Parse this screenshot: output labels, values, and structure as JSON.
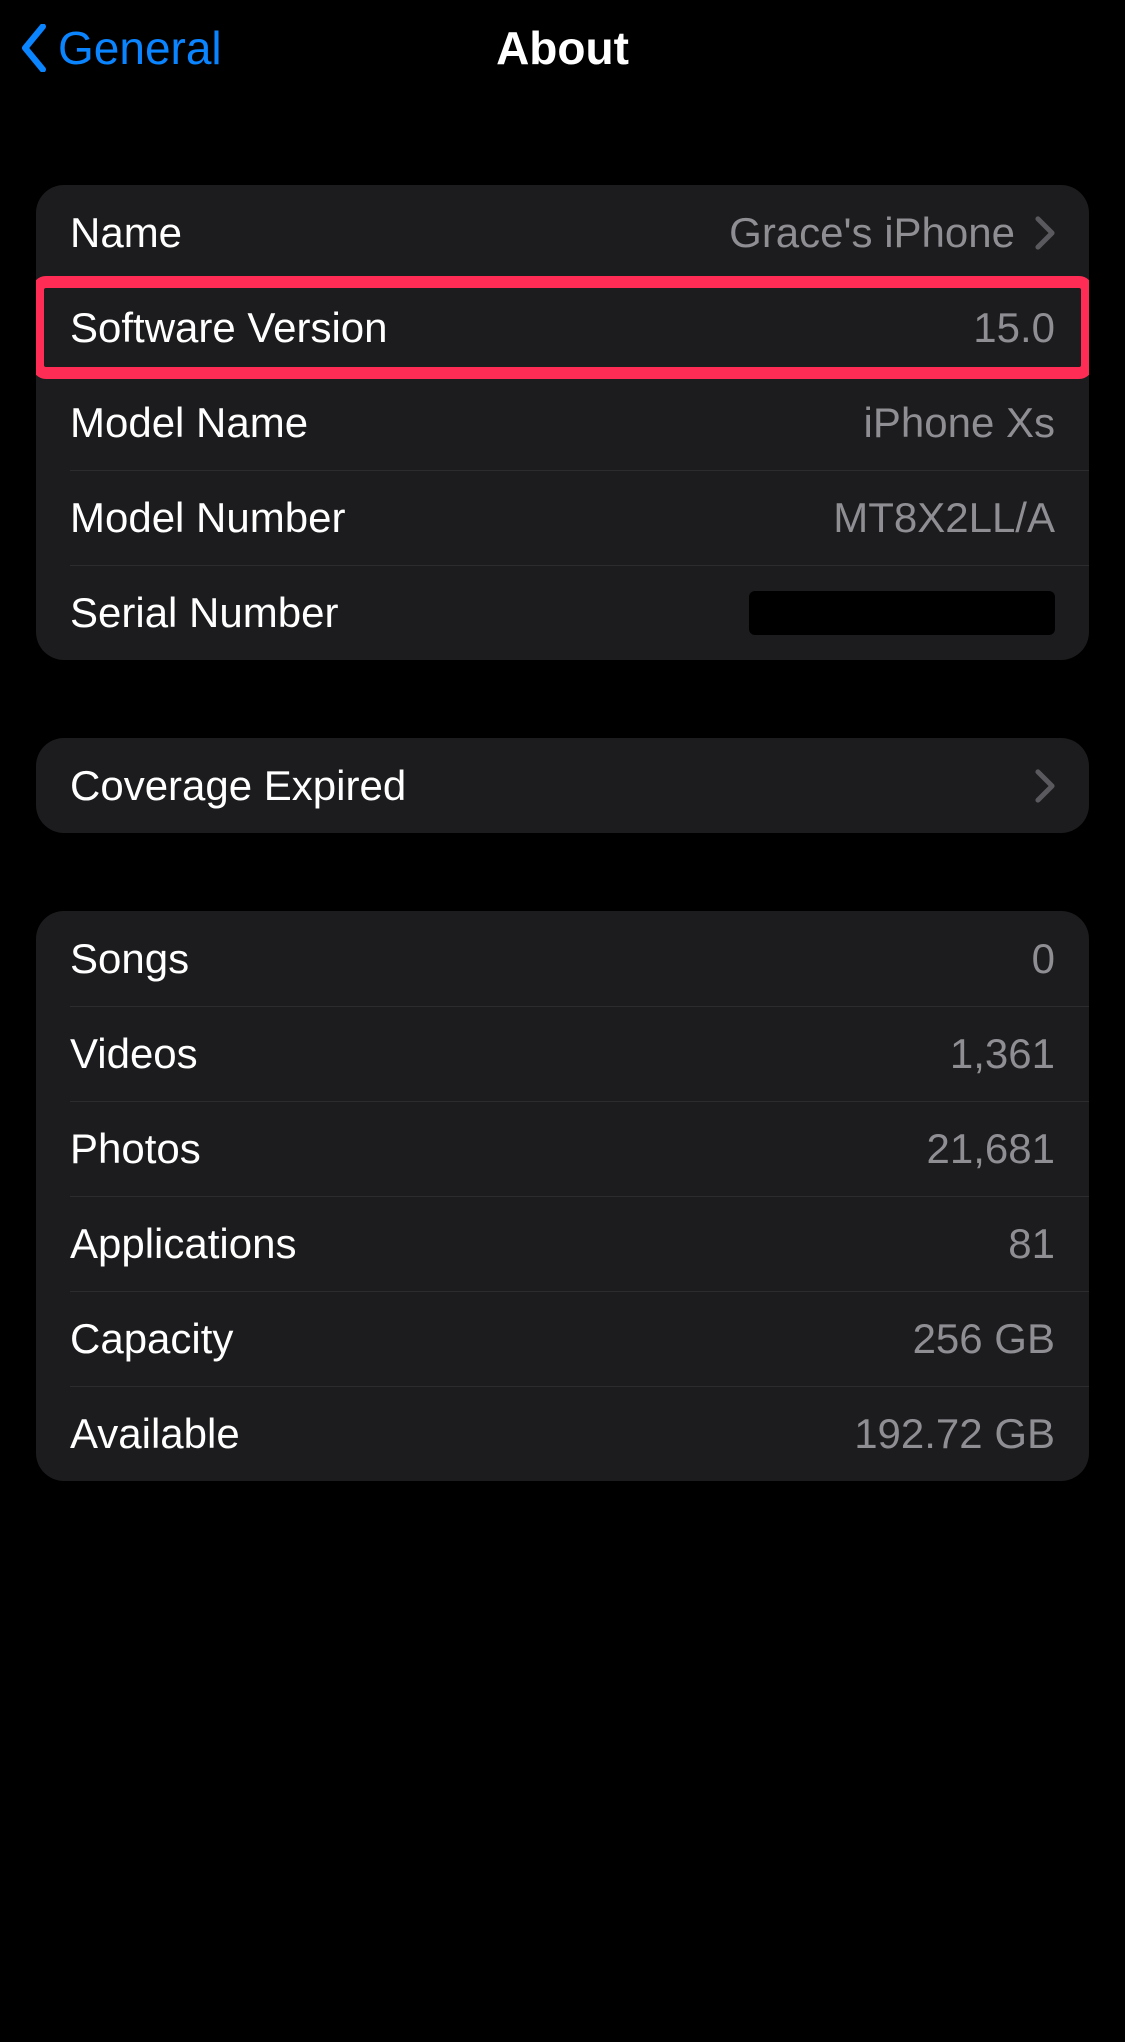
{
  "nav": {
    "back_label": "General",
    "title": "About"
  },
  "group1": {
    "name": {
      "label": "Name",
      "value": "Grace's iPhone"
    },
    "software_version": {
      "label": "Software Version",
      "value": "15.0"
    },
    "model_name": {
      "label": "Model Name",
      "value": "iPhone Xs"
    },
    "model_number": {
      "label": "Model Number",
      "value": "MT8X2LL/A"
    },
    "serial_number": {
      "label": "Serial Number"
    }
  },
  "group2": {
    "coverage": {
      "label": "Coverage Expired"
    }
  },
  "group3": {
    "songs": {
      "label": "Songs",
      "value": "0"
    },
    "videos": {
      "label": "Videos",
      "value": "1,361"
    },
    "photos": {
      "label": "Photos",
      "value": "21,681"
    },
    "applications": {
      "label": "Applications",
      "value": "81"
    },
    "capacity": {
      "label": "Capacity",
      "value": "256 GB"
    },
    "available": {
      "label": "Available",
      "value": "192.72 GB"
    }
  }
}
